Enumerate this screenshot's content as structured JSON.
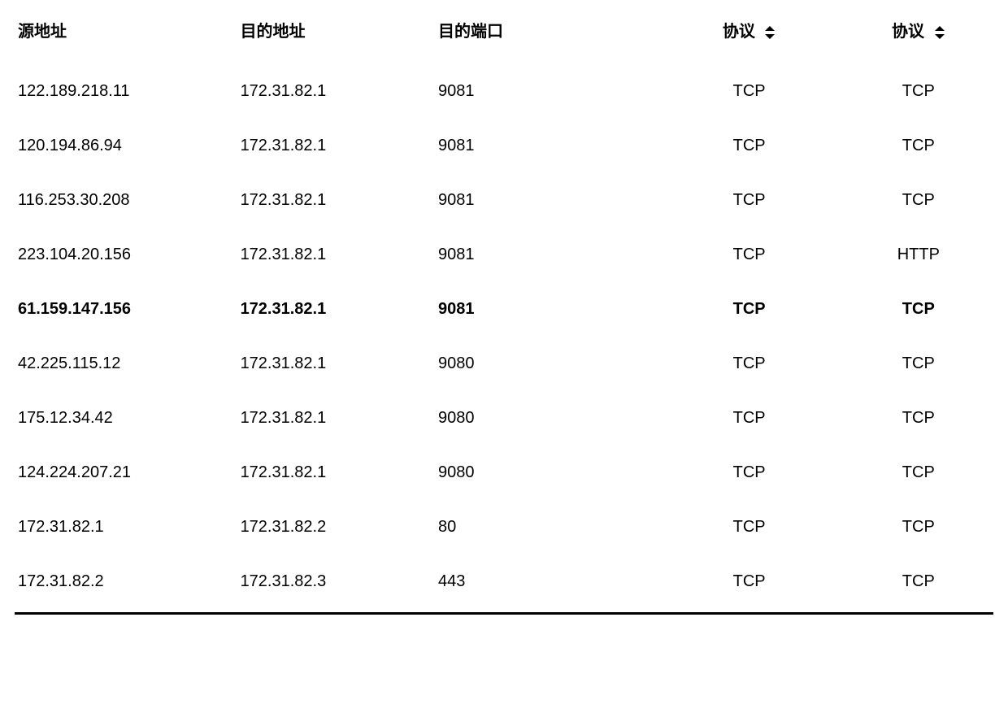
{
  "table": {
    "headers": [
      {
        "label": "源地址",
        "sortable": false,
        "align": "left"
      },
      {
        "label": "目的地址",
        "sortable": false,
        "align": "left"
      },
      {
        "label": "目的端口",
        "sortable": false,
        "align": "left"
      },
      {
        "label": "协议",
        "sortable": true,
        "align": "center"
      },
      {
        "label": "协议",
        "sortable": true,
        "align": "center"
      }
    ],
    "rows": [
      {
        "source": "122.189.218.11",
        "dest": "172.31.82.1",
        "port": "9081",
        "proto1": "TCP",
        "proto2": "TCP",
        "bold": false
      },
      {
        "source": "120.194.86.94",
        "dest": "172.31.82.1",
        "port": "9081",
        "proto1": "TCP",
        "proto2": "TCP",
        "bold": false
      },
      {
        "source": "116.253.30.208",
        "dest": "172.31.82.1",
        "port": "9081",
        "proto1": "TCP",
        "proto2": "TCP",
        "bold": false
      },
      {
        "source": "223.104.20.156",
        "dest": "172.31.82.1",
        "port": "9081",
        "proto1": "TCP",
        "proto2": "HTTP",
        "bold": false
      },
      {
        "source": "61.159.147.156",
        "dest": "172.31.82.1",
        "port": "9081",
        "proto1": "TCP",
        "proto2": "TCP",
        "bold": true
      },
      {
        "source": "42.225.115.12",
        "dest": "172.31.82.1",
        "port": "9080",
        "proto1": "TCP",
        "proto2": "TCP",
        "bold": false
      },
      {
        "source": "175.12.34.42",
        "dest": "172.31.82.1",
        "port": "9080",
        "proto1": "TCP",
        "proto2": "TCP",
        "bold": false
      },
      {
        "source": "124.224.207.21",
        "dest": "172.31.82.1",
        "port": "9080",
        "proto1": "TCP",
        "proto2": "TCP",
        "bold": false
      },
      {
        "source": "172.31.82.1",
        "dest": "172.31.82.2",
        "port": "80",
        "proto1": "TCP",
        "proto2": "TCP",
        "bold": false
      },
      {
        "source": "172.31.82.2",
        "dest": "172.31.82.3",
        "port": "443",
        "proto1": "TCP",
        "proto2": "TCP",
        "bold": false
      }
    ]
  }
}
